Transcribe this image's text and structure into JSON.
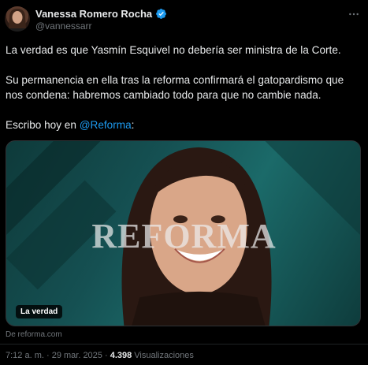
{
  "author": {
    "display_name": "Vanessa Romero Rocha",
    "handle": "@vannessarr",
    "verified": true
  },
  "tweet": {
    "paragraph1": "La verdad es que Yasmín Esquivel no debería ser ministra de la Corte.",
    "paragraph2_line1": "Su permanencia en ella tras la reforma confirmará el gatopardismo que",
    "paragraph2_line2": "nos condena: habremos cambiado todo para que no cambie nada.",
    "paragraph3_prefix": "Escribo hoy en ",
    "paragraph3_mention": "@Reforma",
    "paragraph3_suffix": ":"
  },
  "card": {
    "watermark": "REFORMA",
    "badge": "La verdad",
    "domain": "De reforma.com"
  },
  "meta": {
    "time": "7:12 a. m.",
    "separator": " · ",
    "date": "29 mar. 2025",
    "views_count": "4.398",
    "views_label": " Visualizaciones"
  },
  "colors": {
    "background": "#000000",
    "text": "#e7e9ea",
    "muted": "#71767b",
    "link": "#1d9bf0",
    "verified": "#1d9bf0",
    "card_teal": "#1b6a69"
  },
  "icons": {
    "verified": "verified-badge-icon",
    "more": "more-options-icon"
  }
}
